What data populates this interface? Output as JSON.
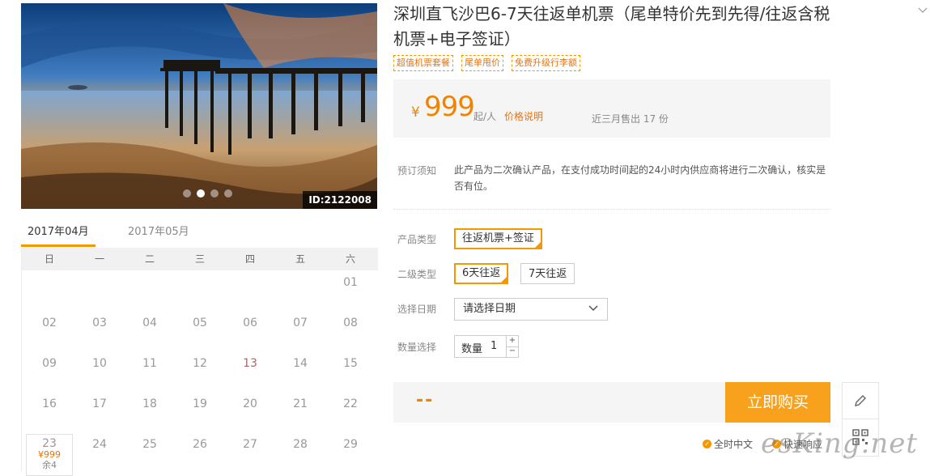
{
  "hero": {
    "image_id": "ID:2122008",
    "slides": 4,
    "active_slide": 2
  },
  "calendar": {
    "months": [
      "2017年04月",
      "2017年05月"
    ],
    "active_month": 0,
    "weekdays": [
      "日",
      "一",
      "二",
      "三",
      "四",
      "五",
      "六"
    ],
    "days": [
      "01",
      "02",
      "03",
      "04",
      "05",
      "06",
      "07",
      "08",
      "09",
      "10",
      "11",
      "12",
      "13",
      "14",
      "15",
      "16",
      "17",
      "18",
      "19",
      "20",
      "21",
      "22",
      "23",
      "24",
      "25",
      "26",
      "27",
      "28",
      "29"
    ],
    "available_day": {
      "day": "23",
      "price": "¥999",
      "remaining": "余4"
    }
  },
  "product": {
    "title": "深圳直飞沙巴6-7天往返单机票（尾单特价先到先得/往返含税机票+电子签证）",
    "tags": [
      "超值机票套餐",
      "尾单甩价",
      "免费升级行李额"
    ],
    "price": {
      "symbol": "¥",
      "value": "999",
      "unit": "起/人",
      "note": "价格说明",
      "sold": "近三月售出 17 份"
    },
    "notice_label": "预订须知",
    "notice_text": "此产品为二次确认产品，在支付成功时间起的24小时内供应商将进行二次确认，核实是否有位。",
    "product_type": {
      "label": "产品类型",
      "options": [
        "往返机票+签证"
      ],
      "selected": 0
    },
    "sub_type": {
      "label": "二级类型",
      "options": [
        "6天往返",
        "7天往返"
      ],
      "selected": 0
    },
    "date": {
      "label": "选择日期",
      "value": "请选择日期"
    },
    "quantity": {
      "label": "数量选择",
      "prefix": "数量",
      "value": "1",
      "plus": "+",
      "minus": "−"
    },
    "total": "--",
    "buy_label": "立即购买",
    "badges": [
      "全时中文",
      "快速响应"
    ]
  },
  "watermark": "esKing.net",
  "colors": {
    "accent": "#f39800",
    "price": "#f08300",
    "buy": "#f8a11c"
  }
}
